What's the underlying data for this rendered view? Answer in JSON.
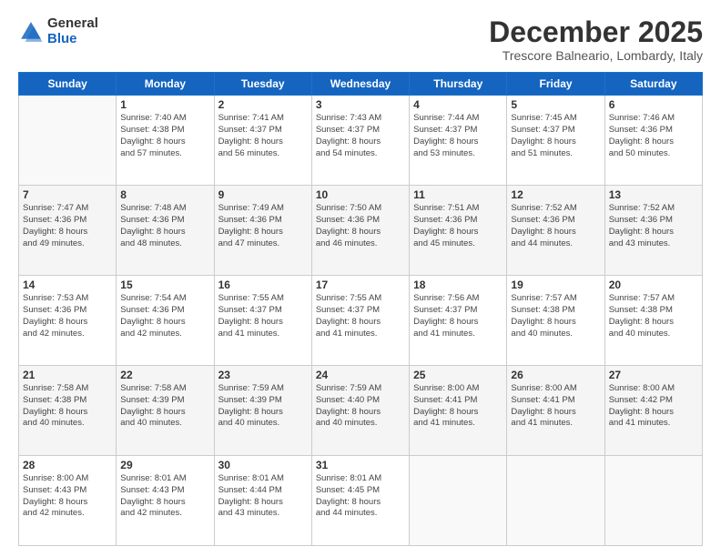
{
  "header": {
    "logo_general": "General",
    "logo_blue": "Blue",
    "month_title": "December 2025",
    "location": "Trescore Balneario, Lombardy, Italy"
  },
  "days_of_week": [
    "Sunday",
    "Monday",
    "Tuesday",
    "Wednesday",
    "Thursday",
    "Friday",
    "Saturday"
  ],
  "weeks": [
    [
      {
        "day": "",
        "info": ""
      },
      {
        "day": "1",
        "info": "Sunrise: 7:40 AM\nSunset: 4:38 PM\nDaylight: 8 hours\nand 57 minutes."
      },
      {
        "day": "2",
        "info": "Sunrise: 7:41 AM\nSunset: 4:37 PM\nDaylight: 8 hours\nand 56 minutes."
      },
      {
        "day": "3",
        "info": "Sunrise: 7:43 AM\nSunset: 4:37 PM\nDaylight: 8 hours\nand 54 minutes."
      },
      {
        "day": "4",
        "info": "Sunrise: 7:44 AM\nSunset: 4:37 PM\nDaylight: 8 hours\nand 53 minutes."
      },
      {
        "day": "5",
        "info": "Sunrise: 7:45 AM\nSunset: 4:37 PM\nDaylight: 8 hours\nand 51 minutes."
      },
      {
        "day": "6",
        "info": "Sunrise: 7:46 AM\nSunset: 4:36 PM\nDaylight: 8 hours\nand 50 minutes."
      }
    ],
    [
      {
        "day": "7",
        "info": "Sunrise: 7:47 AM\nSunset: 4:36 PM\nDaylight: 8 hours\nand 49 minutes."
      },
      {
        "day": "8",
        "info": "Sunrise: 7:48 AM\nSunset: 4:36 PM\nDaylight: 8 hours\nand 48 minutes."
      },
      {
        "day": "9",
        "info": "Sunrise: 7:49 AM\nSunset: 4:36 PM\nDaylight: 8 hours\nand 47 minutes."
      },
      {
        "day": "10",
        "info": "Sunrise: 7:50 AM\nSunset: 4:36 PM\nDaylight: 8 hours\nand 46 minutes."
      },
      {
        "day": "11",
        "info": "Sunrise: 7:51 AM\nSunset: 4:36 PM\nDaylight: 8 hours\nand 45 minutes."
      },
      {
        "day": "12",
        "info": "Sunrise: 7:52 AM\nSunset: 4:36 PM\nDaylight: 8 hours\nand 44 minutes."
      },
      {
        "day": "13",
        "info": "Sunrise: 7:52 AM\nSunset: 4:36 PM\nDaylight: 8 hours\nand 43 minutes."
      }
    ],
    [
      {
        "day": "14",
        "info": "Sunrise: 7:53 AM\nSunset: 4:36 PM\nDaylight: 8 hours\nand 42 minutes."
      },
      {
        "day": "15",
        "info": "Sunrise: 7:54 AM\nSunset: 4:36 PM\nDaylight: 8 hours\nand 42 minutes."
      },
      {
        "day": "16",
        "info": "Sunrise: 7:55 AM\nSunset: 4:37 PM\nDaylight: 8 hours\nand 41 minutes."
      },
      {
        "day": "17",
        "info": "Sunrise: 7:55 AM\nSunset: 4:37 PM\nDaylight: 8 hours\nand 41 minutes."
      },
      {
        "day": "18",
        "info": "Sunrise: 7:56 AM\nSunset: 4:37 PM\nDaylight: 8 hours\nand 41 minutes."
      },
      {
        "day": "19",
        "info": "Sunrise: 7:57 AM\nSunset: 4:38 PM\nDaylight: 8 hours\nand 40 minutes."
      },
      {
        "day": "20",
        "info": "Sunrise: 7:57 AM\nSunset: 4:38 PM\nDaylight: 8 hours\nand 40 minutes."
      }
    ],
    [
      {
        "day": "21",
        "info": "Sunrise: 7:58 AM\nSunset: 4:38 PM\nDaylight: 8 hours\nand 40 minutes."
      },
      {
        "day": "22",
        "info": "Sunrise: 7:58 AM\nSunset: 4:39 PM\nDaylight: 8 hours\nand 40 minutes."
      },
      {
        "day": "23",
        "info": "Sunrise: 7:59 AM\nSunset: 4:39 PM\nDaylight: 8 hours\nand 40 minutes."
      },
      {
        "day": "24",
        "info": "Sunrise: 7:59 AM\nSunset: 4:40 PM\nDaylight: 8 hours\nand 40 minutes."
      },
      {
        "day": "25",
        "info": "Sunrise: 8:00 AM\nSunset: 4:41 PM\nDaylight: 8 hours\nand 41 minutes."
      },
      {
        "day": "26",
        "info": "Sunrise: 8:00 AM\nSunset: 4:41 PM\nDaylight: 8 hours\nand 41 minutes."
      },
      {
        "day": "27",
        "info": "Sunrise: 8:00 AM\nSunset: 4:42 PM\nDaylight: 8 hours\nand 41 minutes."
      }
    ],
    [
      {
        "day": "28",
        "info": "Sunrise: 8:00 AM\nSunset: 4:43 PM\nDaylight: 8 hours\nand 42 minutes."
      },
      {
        "day": "29",
        "info": "Sunrise: 8:01 AM\nSunset: 4:43 PM\nDaylight: 8 hours\nand 42 minutes."
      },
      {
        "day": "30",
        "info": "Sunrise: 8:01 AM\nSunset: 4:44 PM\nDaylight: 8 hours\nand 43 minutes."
      },
      {
        "day": "31",
        "info": "Sunrise: 8:01 AM\nSunset: 4:45 PM\nDaylight: 8 hours\nand 44 minutes."
      },
      {
        "day": "",
        "info": ""
      },
      {
        "day": "",
        "info": ""
      },
      {
        "day": "",
        "info": ""
      }
    ]
  ]
}
